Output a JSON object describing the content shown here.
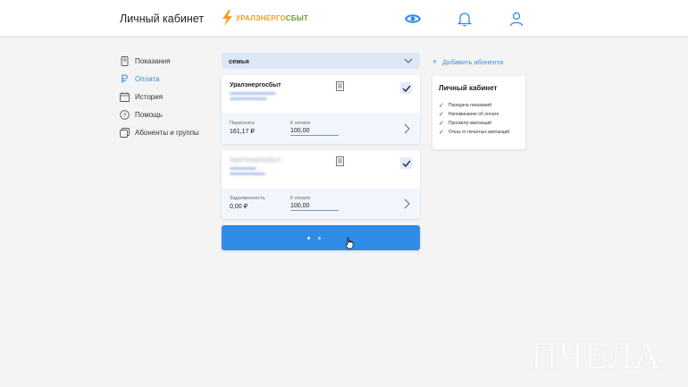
{
  "header": {
    "title": "Личный кабинет",
    "logo_text_a": "УРАЛЭНЕРГО",
    "logo_text_b": "СБЫТ"
  },
  "sidebar": {
    "items": [
      {
        "label": "Показания",
        "icon": "meter-icon",
        "active": false
      },
      {
        "label": "Оплата",
        "icon": "ruble-icon",
        "active": true
      },
      {
        "label": "История",
        "icon": "calendar-icon",
        "active": false
      },
      {
        "label": "Помощь",
        "icon": "help-icon",
        "active": false
      },
      {
        "label": "Абоненты и группы",
        "icon": "groups-icon",
        "active": false
      }
    ]
  },
  "group_select": {
    "value": "семья"
  },
  "add_subscriber": {
    "label": "Добавить абонента"
  },
  "accounts": [
    {
      "name": "Уралэнергосбыт",
      "balance_label": "Переплата",
      "balance_value": "161,17 ₽",
      "pay_label": "К оплате",
      "pay_value": "100,00",
      "checked": true
    },
    {
      "name": "Уралэнергосбыт",
      "balance_label": "Задолженность",
      "balance_value": "0,00 ₽",
      "pay_label": "К оплате",
      "pay_value": "100,00",
      "checked": true
    }
  ],
  "info_panel": {
    "title": "Личный кабинет",
    "features": [
      "Передача показаний",
      "Напоминание об оплате",
      "Просмотр квитанций",
      "Отказ от печатных квитанций"
    ]
  },
  "pay_button": {
    "state": "loading"
  },
  "watermark": {
    "text": "ПЧЕЛА"
  },
  "colors": {
    "accent": "#2e8be6",
    "link": "#3a8dde",
    "check": "#4caa3a",
    "select_bg": "#dbe9f6"
  }
}
